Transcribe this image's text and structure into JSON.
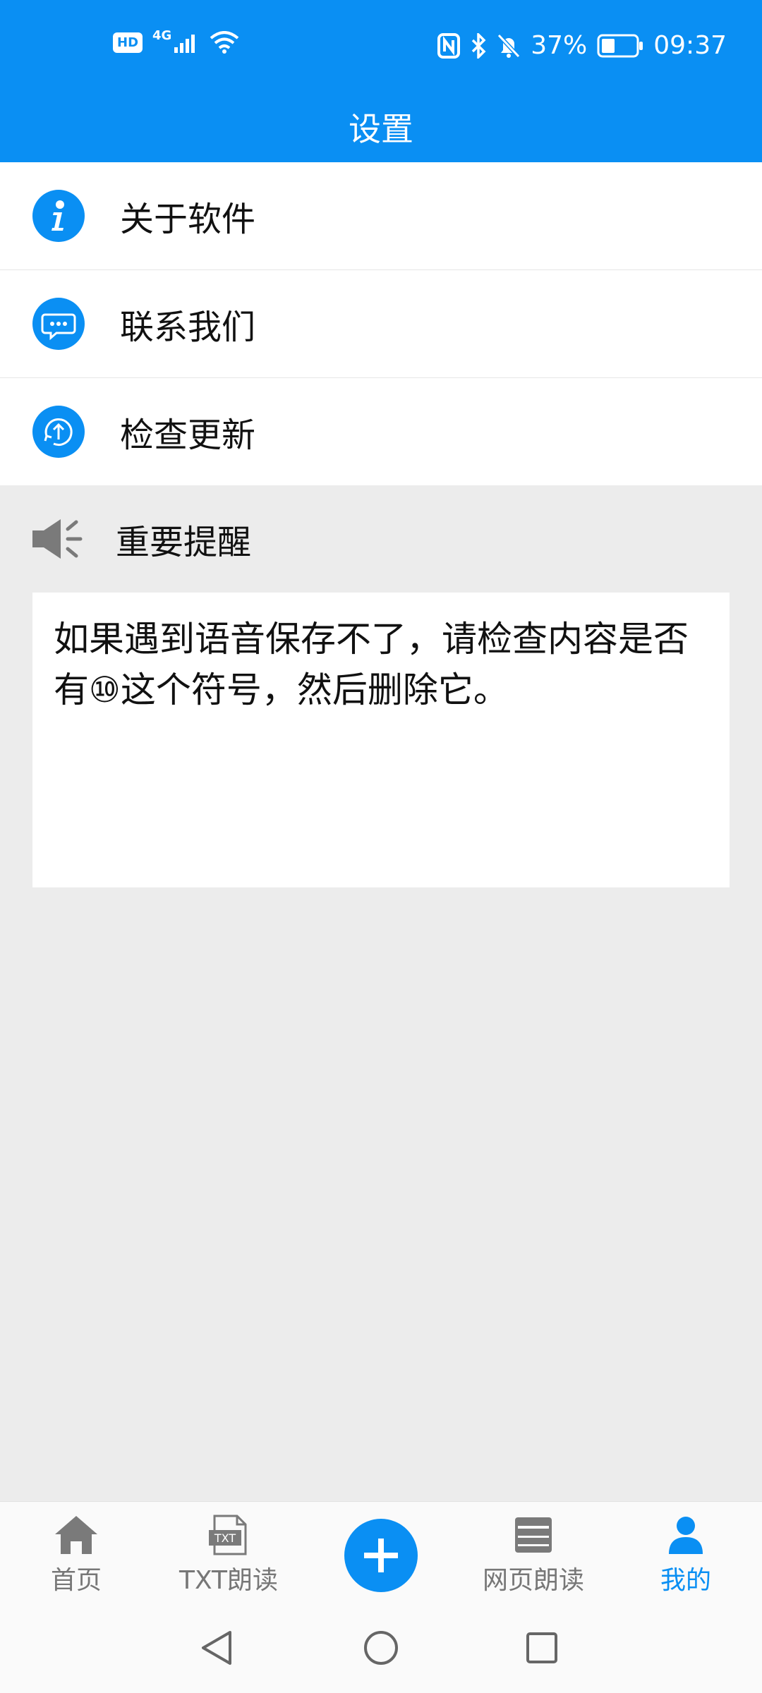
{
  "status_bar": {
    "left_badge": "HD",
    "network": "4G",
    "battery": "37%",
    "time": "09:37"
  },
  "header": {
    "title": "设置"
  },
  "menu": {
    "items": [
      {
        "label": "关于软件",
        "icon": "info-icon"
      },
      {
        "label": "联系我们",
        "icon": "chat-icon"
      },
      {
        "label": "检查更新",
        "icon": "update-icon"
      }
    ]
  },
  "notice": {
    "title": "重要提醒",
    "icon": "speaker-icon",
    "text": "如果遇到语音保存不了，请检查内容是否有⑩这个符号，然后删除它。"
  },
  "bottom_nav": {
    "items": [
      {
        "label": "首页",
        "icon": "home-icon"
      },
      {
        "label": "TXT朗读",
        "icon": "txt-file-icon"
      },
      {
        "label": "网页朗读",
        "icon": "webpage-icon"
      },
      {
        "label": "我的",
        "icon": "user-icon"
      }
    ],
    "add_icon": "plus-icon",
    "active_index": 3,
    "active_color": "#0a8ff3"
  },
  "colors": {
    "primary": "#0a8ff3",
    "background": "#ececec"
  }
}
